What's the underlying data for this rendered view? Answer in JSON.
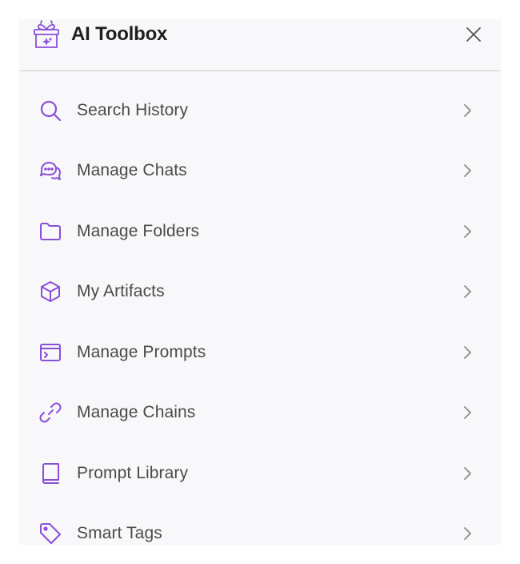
{
  "header": {
    "title": "AI Toolbox",
    "logo_icon": "gift-box-icon",
    "close_icon": "close-icon"
  },
  "colors": {
    "accent": "#8a4fd8",
    "text": "#4a4a4a",
    "title": "#1e1e1e",
    "chevron": "#8c8c8c",
    "panel_bg": "#f8f8fa",
    "divider": "#cfcfc4"
  },
  "menu": {
    "items": [
      {
        "label": "Search History",
        "icon": "search-icon"
      },
      {
        "label": "Manage Chats",
        "icon": "chat-bubbles-icon"
      },
      {
        "label": "Manage Folders",
        "icon": "folder-icon"
      },
      {
        "label": "My Artifacts",
        "icon": "cube-icon"
      },
      {
        "label": "Manage Prompts",
        "icon": "terminal-window-icon"
      },
      {
        "label": "Manage Chains",
        "icon": "link-icon"
      },
      {
        "label": "Prompt Library",
        "icon": "book-icon"
      },
      {
        "label": "Smart Tags",
        "icon": "tag-icon"
      }
    ]
  }
}
